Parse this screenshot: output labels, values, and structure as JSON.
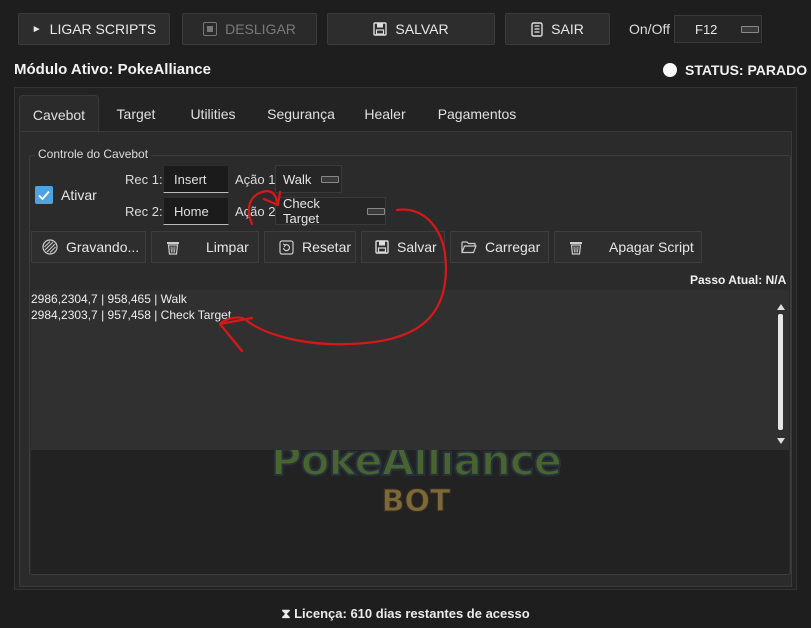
{
  "toolbar": {
    "ligar_label": "LIGAR SCRIPTS",
    "desligar_label": "DESLIGAR",
    "salvar_label": "SALVAR",
    "sair_label": "SAIR",
    "onoff_label": "On/Off",
    "hotkey_value": "F12"
  },
  "header": {
    "module_label": "Módulo Ativo: PokeAlliance",
    "status_label": "STATUS: PARADO"
  },
  "tabs": [
    "Cavebot",
    "Target",
    "Utilities",
    "Segurança",
    "Healer",
    "Pagamentos"
  ],
  "cavebot": {
    "group_title": "Controle do Cavebot",
    "ativar_label": "Ativar",
    "ativar_checked": true,
    "rec1_label": "Rec 1:",
    "rec1_value": "Insert",
    "acao1_label": "Ação 1:",
    "acao1_value": "Walk",
    "rec2_label": "Rec 2:",
    "rec2_value": "Home",
    "acao2_label": "Ação 2:",
    "acao2_value": "Check Target",
    "buttons": {
      "gravando": "Gravando...",
      "limpar": "Limpar",
      "resetar": "Resetar",
      "salvar": "Salvar",
      "carregar": "Carregar",
      "apagar": "Apagar Script"
    },
    "passo_atual": "Passo Atual: N/A",
    "log_lines": [
      "2986,2304,7 | 958,465 | Walk",
      "2984,2303,7 | 957,458 | Check Target"
    ],
    "logo_text": "PokeAlliance",
    "logo_subtext": "BOT"
  },
  "footer": {
    "license_label": "Licença: 610 dias restantes de acesso"
  },
  "colors": {
    "background": "#1e1e1e",
    "checkbox_accent": "#4fa3e0",
    "annotation_red": "#d81818"
  }
}
